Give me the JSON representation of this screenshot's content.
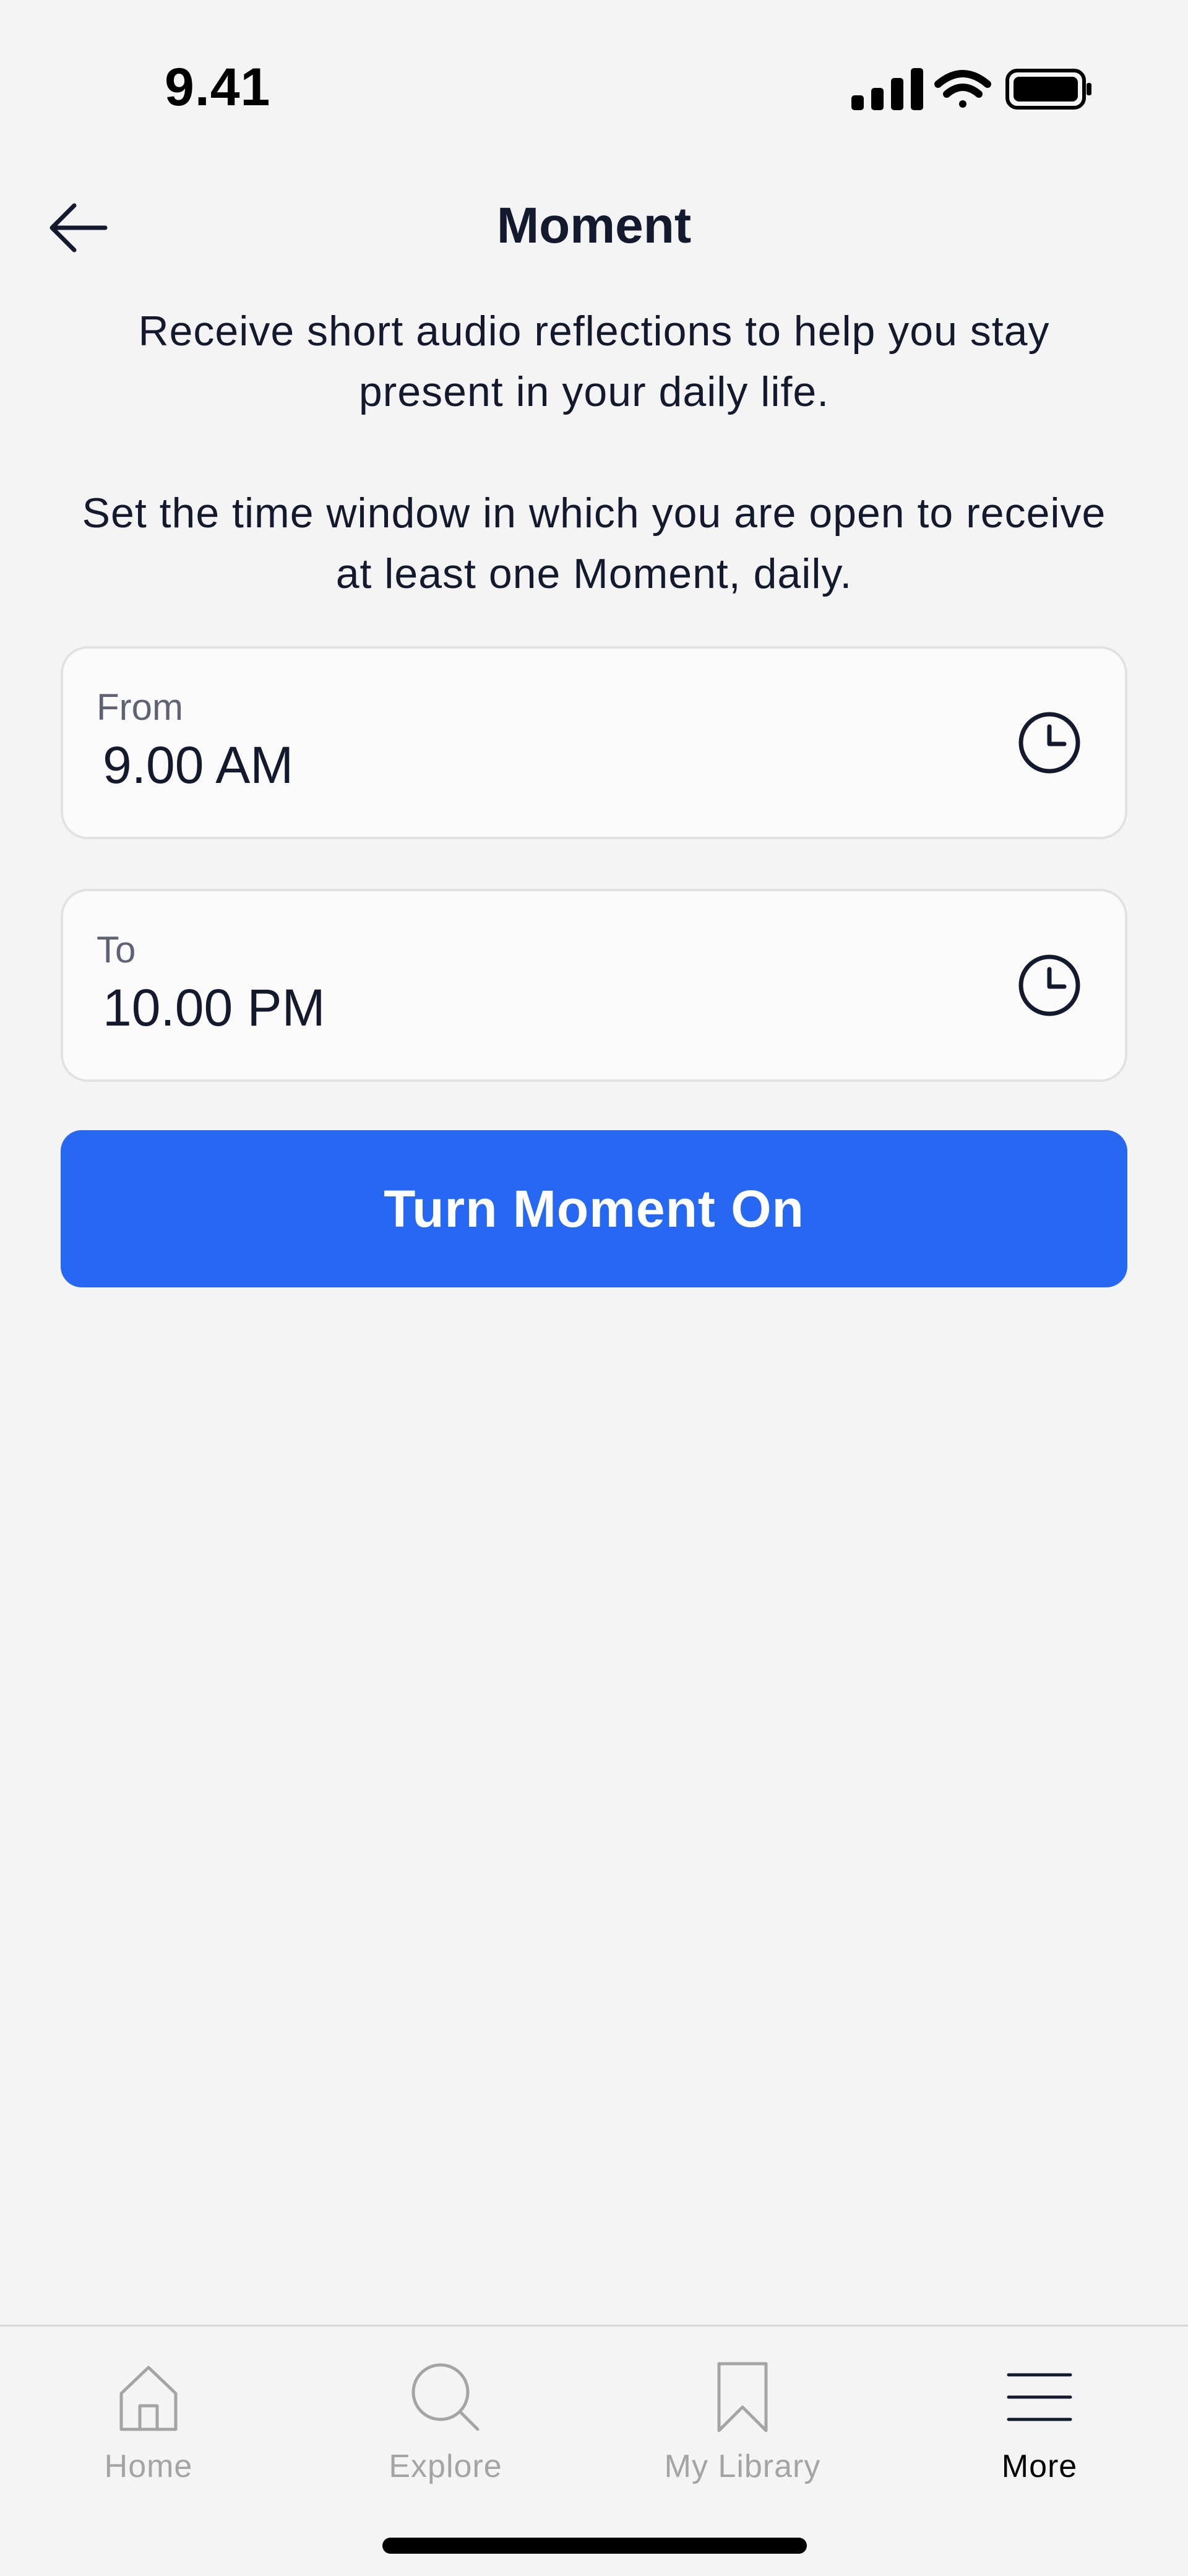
{
  "status_bar": {
    "time": "9.41"
  },
  "header": {
    "title": "Moment"
  },
  "description": {
    "line1": "Receive short audio reflections to help you stay present in your daily life.",
    "line2": "Set the time window in which you are open to receive at least one Moment, daily."
  },
  "fields": {
    "from": {
      "label": "From",
      "value": "9.00 AM"
    },
    "to": {
      "label": "To",
      "value": "10.00 PM"
    }
  },
  "primary_button": {
    "label": "Turn Moment On"
  },
  "tabbar": {
    "items": [
      {
        "label": "Home",
        "icon": "home-icon",
        "active": false
      },
      {
        "label": "Explore",
        "icon": "search-icon",
        "active": false
      },
      {
        "label": "My Library",
        "icon": "bookmark-icon",
        "active": false
      },
      {
        "label": "More",
        "icon": "menu-icon",
        "active": true
      }
    ]
  },
  "colors": {
    "accent": "#2768f2",
    "background": "#f4f4f4",
    "text": "#131a2e",
    "inactive_tab": "#a4a4a4"
  }
}
